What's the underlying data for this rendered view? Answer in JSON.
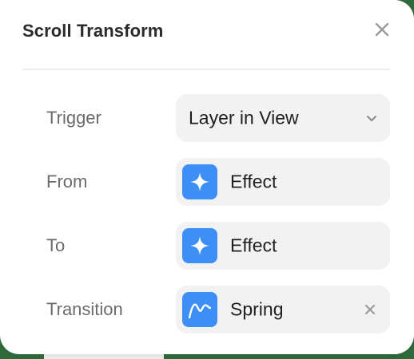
{
  "panel": {
    "title": "Scroll Transform"
  },
  "rows": {
    "trigger": {
      "label": "Trigger",
      "value": "Layer in View",
      "icon": "chevron-down-icon"
    },
    "from": {
      "label": "From",
      "value": "Effect",
      "icon": "sparkle-icon",
      "icon_color": "#3d8ff5"
    },
    "to": {
      "label": "To",
      "value": "Effect",
      "icon": "sparkle-icon",
      "icon_color": "#3d8ff5"
    },
    "transition": {
      "label": "Transition",
      "value": "Spring",
      "icon": "spring-curve-icon",
      "icon_color": "#3d8ff5"
    }
  },
  "colors": {
    "panel_bg": "#ffffff",
    "field_bg": "#f2f2f2",
    "accent": "#3d8ff5",
    "backdrop": "#2f6b3a"
  }
}
